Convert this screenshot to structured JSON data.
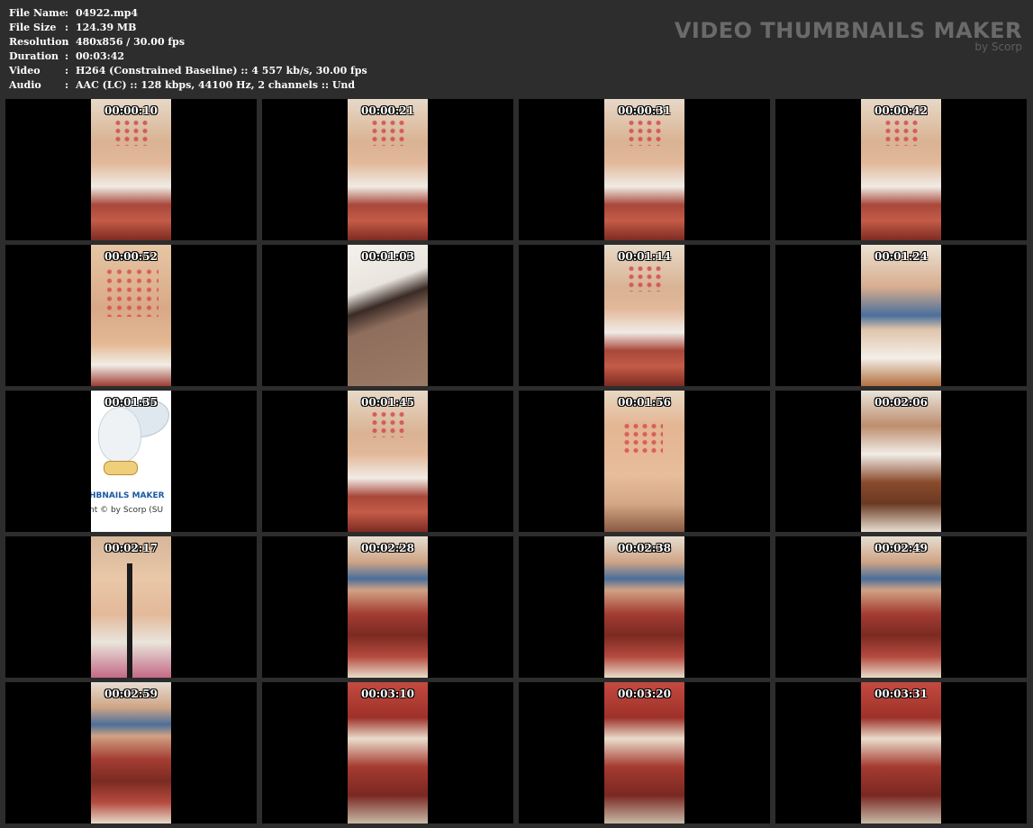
{
  "metadata": [
    {
      "key": "File Name",
      "sep": ":",
      "value": "04922.mp4"
    },
    {
      "key": "File Size",
      "sep": ":",
      "value": "124.39 MB"
    },
    {
      "key": "Resolution",
      "sep": ":",
      "value": "480x856 / 30.00 fps"
    },
    {
      "key": "Duration",
      "sep": ":",
      "value": "00:03:42"
    },
    {
      "key": "Video",
      "sep": ":",
      "value": "H264 (Constrained Baseline) :: 4 557 kb/s, 30.00 fps"
    },
    {
      "key": "Audio",
      "sep": ":",
      "value": "AAC (LC) :: 128 kbps, 44100 Hz, 2 channels :: Und"
    }
  ],
  "brand": {
    "title": "VIDEO THUMBNAILS MAKER",
    "subtitle": "by Scorp"
  },
  "watermark": {
    "line1": "HBNAILS MAKER",
    "line2": "nt © by Scorp (SU"
  },
  "thumbnails": [
    {
      "timestamp": "00:00:10",
      "scene": "chest"
    },
    {
      "timestamp": "00:00:21",
      "scene": "chest"
    },
    {
      "timestamp": "00:00:31",
      "scene": "chest"
    },
    {
      "timestamp": "00:00:42",
      "scene": "chest"
    },
    {
      "timestamp": "00:00:52",
      "scene": "close"
    },
    {
      "timestamp": "00:01:03",
      "scene": "face"
    },
    {
      "timestamp": "00:01:14",
      "scene": "chest"
    },
    {
      "timestamp": "00:01:24",
      "scene": "bed"
    },
    {
      "timestamp": "00:01:35",
      "scene": "owl"
    },
    {
      "timestamp": "00:01:45",
      "scene": "chest"
    },
    {
      "timestamp": "00:01:56",
      "scene": "belly"
    },
    {
      "timestamp": "00:02:06",
      "scene": "hand"
    },
    {
      "timestamp": "00:02:17",
      "scene": "legs"
    },
    {
      "timestamp": "00:02:28",
      "scene": "dress"
    },
    {
      "timestamp": "00:02:38",
      "scene": "dress"
    },
    {
      "timestamp": "00:02:49",
      "scene": "dress"
    },
    {
      "timestamp": "00:02:59",
      "scene": "dress"
    },
    {
      "timestamp": "00:03:10",
      "scene": "dress2"
    },
    {
      "timestamp": "00:03:20",
      "scene": "dress2"
    },
    {
      "timestamp": "00:03:31",
      "scene": "dress2"
    }
  ],
  "colors": {
    "background": "#2d2d2d",
    "cell_background": "#000000",
    "text": "#ffffff",
    "brand": "#6a6a6a"
  }
}
